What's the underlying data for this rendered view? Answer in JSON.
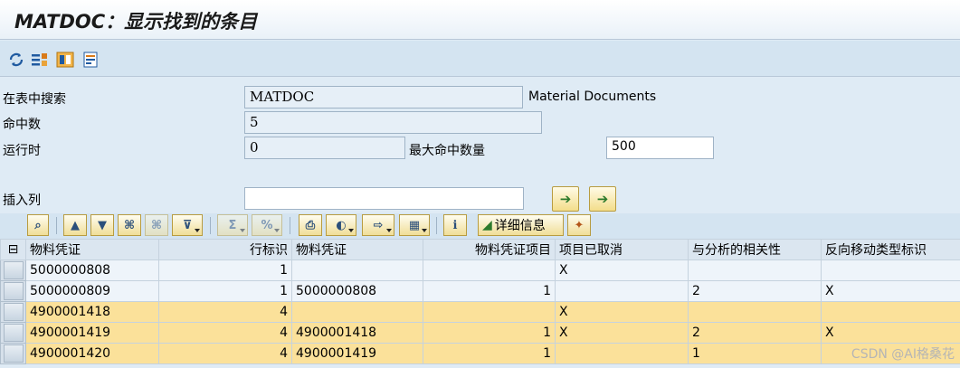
{
  "title": "MATDOC：显示找到的条目",
  "app_toolbar": [
    "refresh-icon",
    "list-settings-icon",
    "layout-icon",
    "save-icon"
  ],
  "form": {
    "search_table_label": "在表中搜索",
    "search_table_value": "MATDOC",
    "search_table_desc": "Material Documents",
    "hits_label": "命中数",
    "hits_value": "5",
    "runtime_label": "运行时",
    "runtime_value": "0",
    "max_hits_label": "最大命中数量",
    "max_hits_value": "500",
    "insert_col_label": "插入列",
    "insert_col_value": ""
  },
  "grid_toolbar": {
    "details_label": "详细信息"
  },
  "table": {
    "headers": [
      "物料凭证",
      "行标识",
      "物料凭证",
      "物料凭证项目",
      "项目已取消",
      "与分析的相关性",
      "反向移动类型标识"
    ],
    "rows": [
      {
        "cells": [
          "5000000808",
          "1",
          "",
          "",
          "X",
          "",
          ""
        ],
        "highlight": false
      },
      {
        "cells": [
          "5000000809",
          "1",
          "5000000808",
          "1",
          "",
          "2",
          "X"
        ],
        "highlight": false
      },
      {
        "cells": [
          "4900001418",
          "4",
          "",
          "",
          "X",
          "",
          ""
        ],
        "highlight": true
      },
      {
        "cells": [
          "4900001419",
          "4",
          "4900001418",
          "1",
          "X",
          "2",
          "X"
        ],
        "highlight": true
      },
      {
        "cells": [
          "4900001420",
          "4",
          "4900001419",
          "1",
          "",
          "1",
          ""
        ],
        "highlight": true
      }
    ]
  },
  "watermark": "CSDN @AI格桑花",
  "colors": {
    "highlight_row": "#fbe19a",
    "background": "#dfebf5"
  }
}
